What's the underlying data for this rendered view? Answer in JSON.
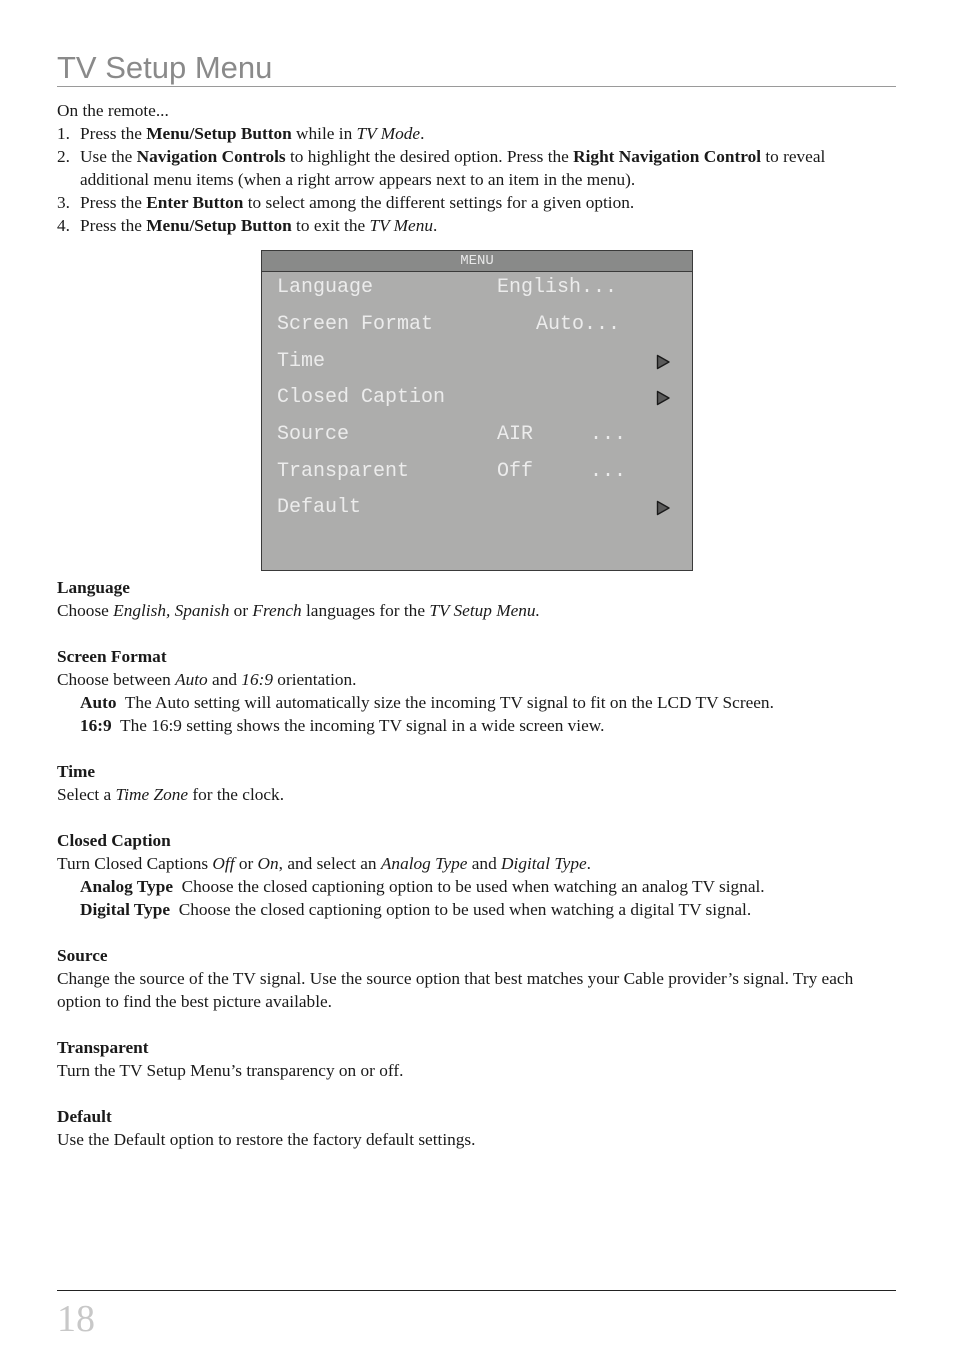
{
  "header": {
    "title": "TV Setup Menu"
  },
  "intro": {
    "lead": "On the remote...",
    "steps": [
      {
        "num": "1.",
        "parts": [
          "Press the ",
          "Menu/Setup Button",
          " while in ",
          "TV Mode",
          "."
        ]
      },
      {
        "num": "2.",
        "parts": [
          "Use the ",
          "Navigation Controls",
          " to highlight the desired option.  Press the ",
          "Right Navigation Control",
          " to reveal additional menu items (when a right arrow appears next to an item in the menu)."
        ]
      },
      {
        "num": "3.",
        "parts": [
          "Press the ",
          "Enter Button",
          " to select among the different settings for a given option."
        ]
      },
      {
        "num": "4.",
        "parts": [
          "Press the ",
          "Menu/Setup Button",
          " to exit the ",
          "TV Menu",
          "."
        ]
      }
    ]
  },
  "tv_menu": {
    "header": "MENU",
    "colors": {
      "background": "#adadac",
      "header_bg": "#898a89",
      "text": "#ececec",
      "arrow": "#5a5a5a"
    },
    "items": [
      {
        "label": "Language",
        "value": "English...",
        "dots": "",
        "arrow": false
      },
      {
        "label": "Screen Format",
        "value": "Auto...",
        "dots": "",
        "arrow": false
      },
      {
        "label": "Time",
        "value": "",
        "dots": "",
        "arrow": true,
        "icon": "right-arrow-icon"
      },
      {
        "label": "Closed Caption",
        "value": "",
        "dots": "",
        "arrow": true,
        "icon": "right-arrow-icon"
      },
      {
        "label": "Source",
        "value": "AIR",
        "dots": "...",
        "arrow": false
      },
      {
        "label": "Transparent",
        "value": "Off",
        "dots": "...",
        "arrow": false
      },
      {
        "label": "Default",
        "value": "",
        "dots": "",
        "arrow": true,
        "icon": "right-arrow-icon"
      }
    ]
  },
  "sections": {
    "language": {
      "title": "Language",
      "parts": [
        "Choose ",
        "English, Spanish",
        " or ",
        "French",
        " languages for the ",
        "TV Setup Menu."
      ]
    },
    "screen_format": {
      "title": "Screen Format",
      "parts": [
        "Choose between ",
        "Auto",
        " and ",
        "16:9",
        " orientation."
      ],
      "subs": [
        {
          "term": "Auto",
          "text": "  The Auto setting will automatically size the incoming TV signal to fit on the LCD TV Screen."
        },
        {
          "term": "16:9",
          "text": "  The 16:9 setting shows the incoming TV signal in a wide screen view."
        }
      ]
    },
    "time": {
      "title": "Time",
      "parts": [
        "Select a ",
        "Time Zone",
        " for the clock."
      ]
    },
    "closed_caption": {
      "title": "Closed Caption",
      "parts": [
        "Turn Closed Captions ",
        "Off",
        " or ",
        "On",
        ", and select an ",
        "Analog Type",
        " and ",
        "Digital Type",
        "."
      ],
      "subs": [
        {
          "term": "Analog Type",
          "text": "  Choose the closed captioning option to be used when watching an analog TV signal."
        },
        {
          "term": "Digital Type",
          "text": "  Choose the closed captioning option to be used when watching a digital TV signal."
        }
      ]
    },
    "source": {
      "title": "Source",
      "text": "Change the source of the TV signal.  Use the source option that best matches your Cable provider’s signal. Try each option to find the best picture available."
    },
    "transparent": {
      "title": "Transparent",
      "text": "Turn the TV Setup Menu’s transparency on or off."
    },
    "default": {
      "title": "Default",
      "text": "Use the Default option to restore the factory default settings."
    }
  },
  "footer": {
    "page_number": "18"
  }
}
